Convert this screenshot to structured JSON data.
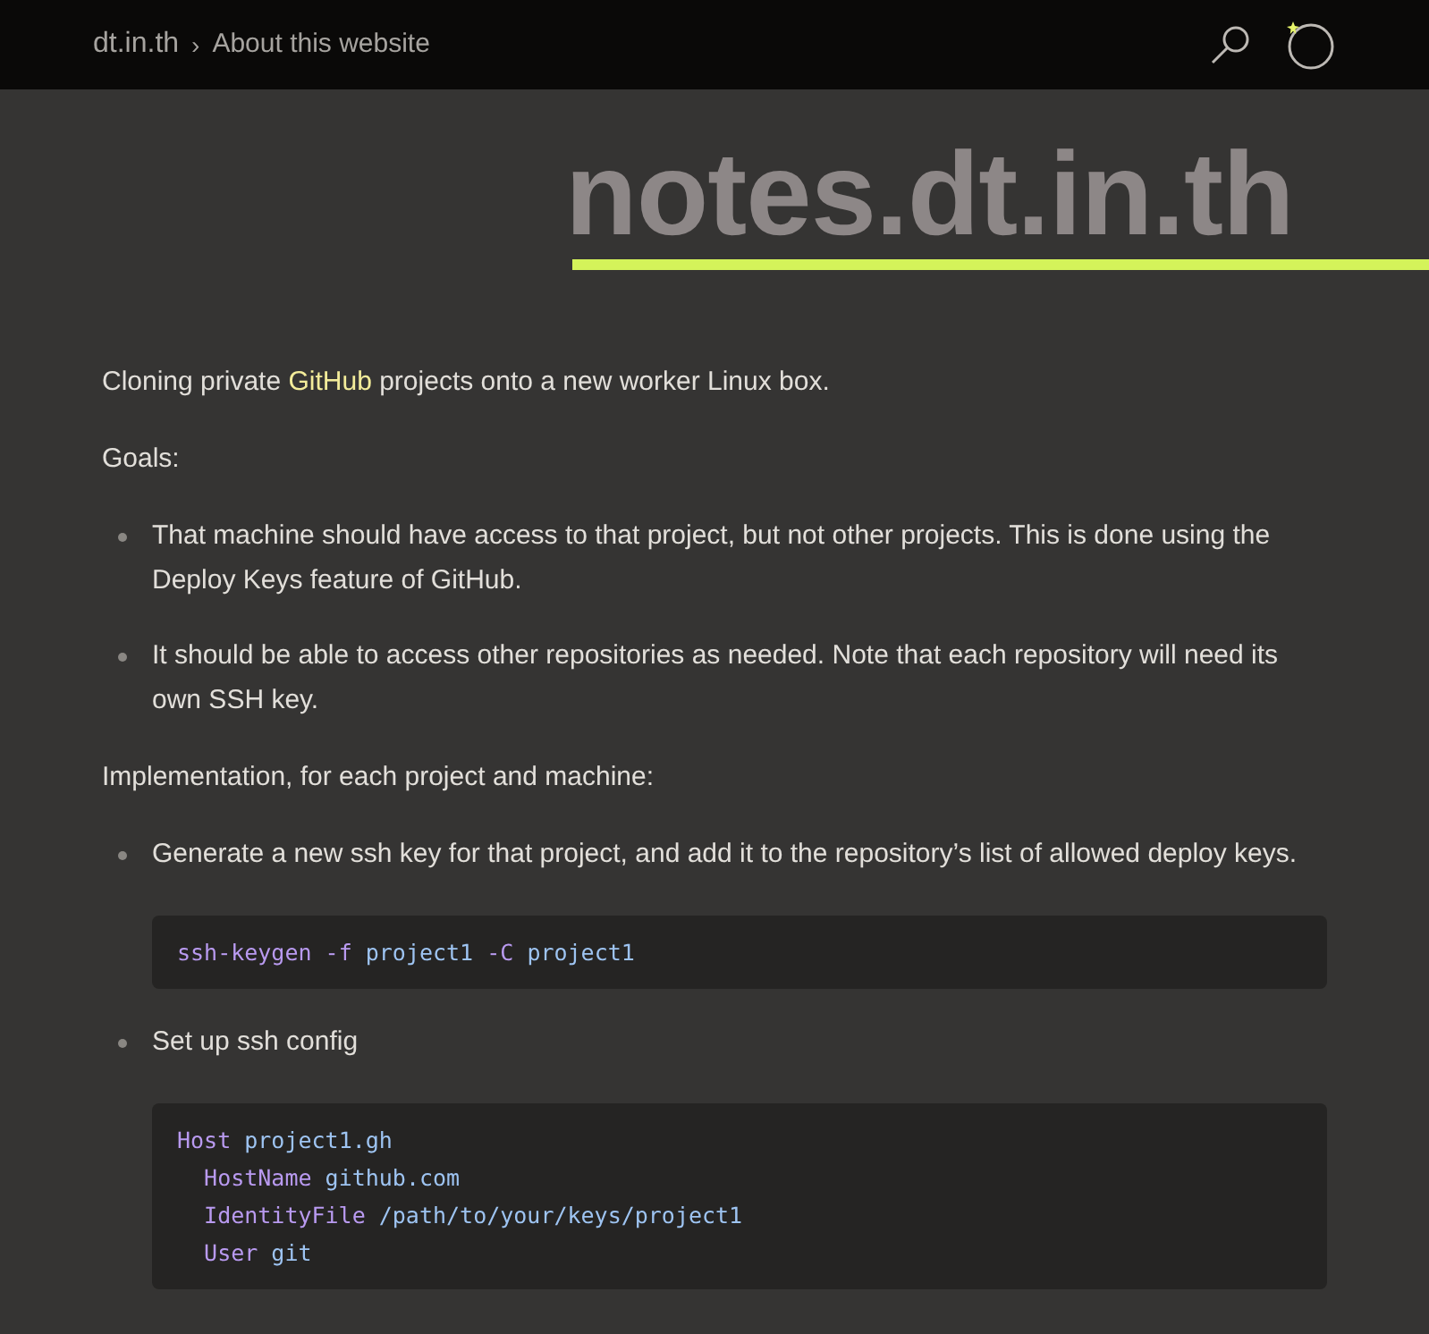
{
  "header": {
    "site": "dt.in.th",
    "separator": "›",
    "page": "About this website"
  },
  "title": "notes.dt.in.th",
  "content": [
    {
      "kind": "paragraph",
      "parts": [
        {
          "text": "Cloning private ",
          "kind": "plain"
        },
        {
          "text": "GitHub",
          "kind": "link"
        },
        {
          "text": " projects onto a new worker Linux box.",
          "kind": "plain"
        }
      ]
    },
    {
      "kind": "paragraph",
      "parts": [
        {
          "text": "Goals:",
          "kind": "plain"
        }
      ]
    },
    {
      "kind": "list",
      "items": [
        {
          "text": "That machine should have access to that project, but not other projects. This is done using the Deploy Keys feature of GitHub."
        },
        {
          "text": "It should be able to access other repositories as needed. Note that each repository will need its own SSH key."
        }
      ]
    },
    {
      "kind": "paragraph",
      "parts": [
        {
          "text": "Implementation, for each project and machine:",
          "kind": "plain"
        }
      ]
    },
    {
      "kind": "list",
      "items": [
        {
          "text": "Generate a new ssh key for that project, and add it to the repository’s list of allowed deploy keys.",
          "code": [
            [
              {
                "text": "ssh-keygen",
                "kind": "keyword"
              },
              {
                "text": " -f ",
                "kind": "flag"
              },
              {
                "text": "project1",
                "kind": "value"
              },
              {
                "text": " -C ",
                "kind": "flag"
              },
              {
                "text": "project1",
                "kind": "value"
              }
            ]
          ]
        },
        {
          "text": "Set up ssh config",
          "code": [
            [
              {
                "text": "Host",
                "kind": "keyword"
              },
              {
                "text": " project1.gh",
                "kind": "value"
              }
            ],
            [
              {
                "text": "  HostName",
                "kind": "keyword"
              },
              {
                "text": " github.com",
                "kind": "value"
              }
            ],
            [
              {
                "text": "  IdentityFile",
                "kind": "keyword"
              },
              {
                "text": " /path/to/your/keys/project1",
                "kind": "value"
              }
            ],
            [
              {
                "text": "  User",
                "kind": "keyword"
              },
              {
                "text": " git",
                "kind": "value"
              }
            ]
          ]
        }
      ]
    }
  ]
}
